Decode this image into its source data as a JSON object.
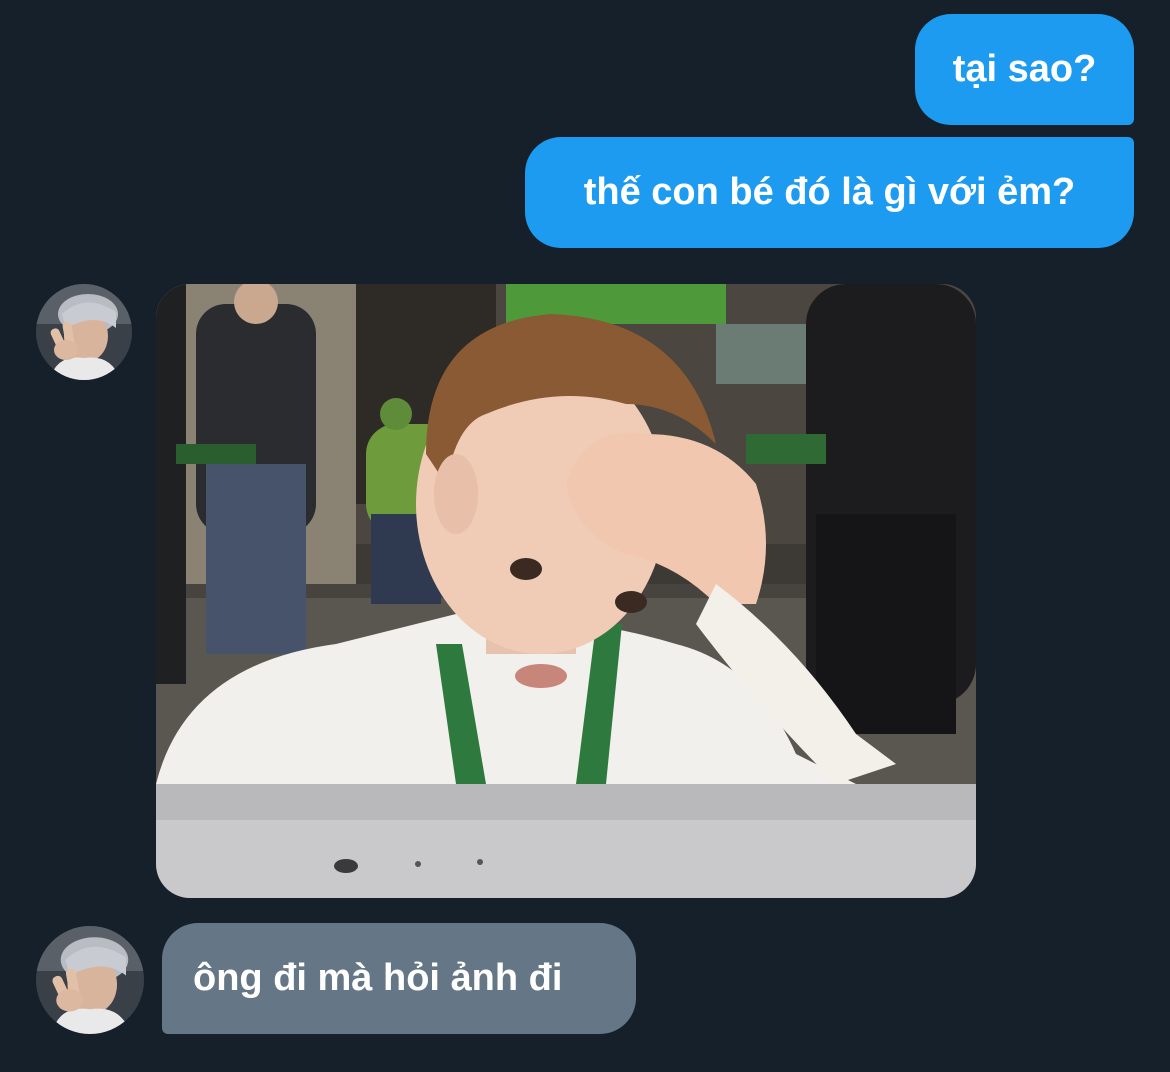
{
  "conversation": {
    "messages": [
      {
        "direction": "sent",
        "text": "tại sao?"
      },
      {
        "direction": "sent",
        "text": "thế con bé đó là gì với ẻm?"
      },
      {
        "direction": "received",
        "type": "image",
        "image_subject": "boy-facepalm-meme"
      },
      {
        "direction": "received",
        "text": "ông đi mà hỏi ảnh đi"
      }
    ]
  },
  "icons": {
    "avatar": "user-avatar-icon"
  },
  "colors": {
    "background": "#15202b",
    "sent_bubble": "#1d9bf0",
    "received_bubble": "#657786",
    "text": "#ffffff"
  }
}
